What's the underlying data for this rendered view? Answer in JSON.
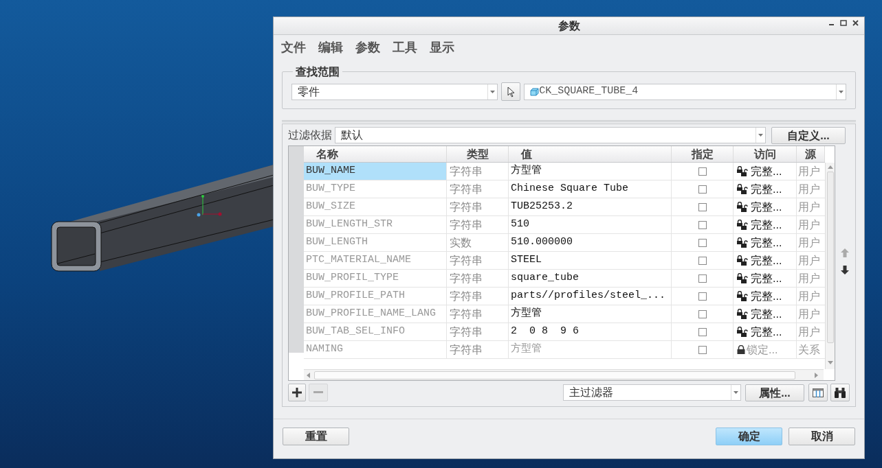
{
  "window": {
    "title": "参数"
  },
  "menu": [
    "文件",
    "编辑",
    "参数",
    "工具",
    "显示"
  ],
  "look_in": {
    "legend": "查找范围",
    "scope": "零件",
    "object": "CK_SQUARE_TUBE_4"
  },
  "filter": {
    "label": "过滤依据",
    "value": "默认",
    "button": "自定义..."
  },
  "table": {
    "columns": [
      "名称",
      "类型",
      "值",
      "指定",
      "访问",
      "源"
    ],
    "rows": [
      {
        "name": "BUW_NAME",
        "type": "字符串",
        "value": "方型管",
        "designated": false,
        "access": "完整...",
        "locked": false,
        "source": "用户",
        "selected": true
      },
      {
        "name": "BUW_TYPE",
        "type": "字符串",
        "value": "Chinese Square Tube",
        "designated": false,
        "access": "完整...",
        "locked": false,
        "source": "用户",
        "selected": false
      },
      {
        "name": "BUW_SIZE",
        "type": "字符串",
        "value": "TUB25253.2",
        "designated": false,
        "access": "完整...",
        "locked": false,
        "source": "用户",
        "selected": false
      },
      {
        "name": "BUW_LENGTH_STR",
        "type": "字符串",
        "value": "510",
        "designated": false,
        "access": "完整...",
        "locked": false,
        "source": "用户",
        "selected": false
      },
      {
        "name": "BUW_LENGTH",
        "type": "实数",
        "value": "510.000000",
        "designated": false,
        "access": "完整...",
        "locked": false,
        "source": "用户",
        "selected": false
      },
      {
        "name": "PTC_MATERIAL_NAME",
        "type": "字符串",
        "value": "STEEL",
        "designated": false,
        "access": "完整...",
        "locked": false,
        "source": "用户",
        "selected": false
      },
      {
        "name": "BUW_PROFIL_TYPE",
        "type": "字符串",
        "value": "square_tube",
        "designated": false,
        "access": "完整...",
        "locked": false,
        "source": "用户",
        "selected": false
      },
      {
        "name": "BUW_PROFILE_PATH",
        "type": "字符串",
        "value": "parts//profiles/steel_...",
        "designated": false,
        "access": "完整...",
        "locked": false,
        "source": "用户",
        "selected": false
      },
      {
        "name": "BUW_PROFILE_NAME_LANG",
        "type": "字符串",
        "value": "方型管",
        "designated": false,
        "access": "完整...",
        "locked": false,
        "source": "用户",
        "selected": false
      },
      {
        "name": "BUW_TAB_SEL_INFO",
        "type": "字符串",
        "value": "2  0 8  9 6",
        "designated": false,
        "access": "完整...",
        "locked": false,
        "source": "用户",
        "selected": false
      },
      {
        "name": "NAMING",
        "type": "字符串",
        "value": "方型管",
        "designated": false,
        "access": "锁定...",
        "locked": true,
        "source": "关系",
        "selected": false
      }
    ]
  },
  "toolbar": {
    "remove_disabled": true,
    "filter": "主过滤器",
    "properties": "属性..."
  },
  "buttons": [
    {
      "label": "重置",
      "default": false
    },
    {
      "label": "确定",
      "default": true
    },
    {
      "label": "取消",
      "default": false
    }
  ]
}
